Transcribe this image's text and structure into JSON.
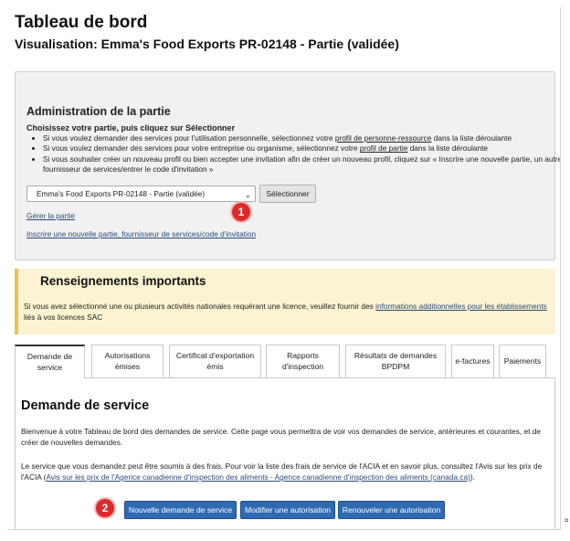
{
  "page": {
    "title": "Tableau de bord",
    "subtitle": "Visualisation: Emma's Food Exports PR-02148 - Partie (validée)"
  },
  "admin": {
    "heading": "Administration de la partie",
    "instruction": "Choisissez votre partie, puis cliquez sur Sélectionner",
    "bullets": [
      {
        "before": "Si vous voulez demander des services pour l'utilisation personnelle, sélectionnez votre ",
        "link": "profil de personne-ressource",
        "after": " dans la liste déroulante"
      },
      {
        "before": "Si vous voulez demander des services pour votre entreprise ou organisme, sélectionnez votre ",
        "link": "profil de partie",
        "after": " dans la liste déroulante"
      },
      {
        "text": "Si vous souhaiter créer un nouveau profil ou bien accepter une invitation afin de créer un nouveau profil, cliquez sur « Inscrire une nouvelle partie, un autre fournisseur de services/entrer le code d'invitation »"
      }
    ],
    "select_value": "Emma's Food Exports PR-02148 - Partie (validée)",
    "select_button": "Sélectionner",
    "manage_link": "Gérer la partie",
    "register_link": "Inscrire une nouvelle partie, fournisseur de services/code d'invitation",
    "callout": "1"
  },
  "info": {
    "heading": "Renseignements importants",
    "text_before": "Si vous avez sélectionné une ou plusieurs activités nationales requérant une licence, veuillez fournir des ",
    "link": "informations additionnelles pour les établissements",
    "text_after": " liés à vos licences SAC"
  },
  "tabs": [
    {
      "label": "Demande de service",
      "active": true
    },
    {
      "label": "Autorisations émises"
    },
    {
      "label": "Certificat d'exportation émis"
    },
    {
      "label": "Rapports d'inspection"
    },
    {
      "label": "Résultats de demandes BPDPM"
    },
    {
      "label": "e-factures"
    },
    {
      "label": "Paiements"
    }
  ],
  "panel": {
    "title": "Demande de service",
    "intro": "Bienvenue à votre Tableau de bord des demandes de service. Cette page vous permettra de voir vos demandes de service, antérieures et courantes, et de créer de nouvelles demandes.",
    "fees_before": "Le service que vous demandez peut être soumis à des frais. Pour voir la liste des frais de service de l'ACIA et en savoir plus, consultez l'Avis sur les prix de l'ACIA (",
    "fees_link": "Avis sur les prix de l'Agence canadienne d'inspection des aliments - Agence canadienne d'inspection des aliments (canada.ca)",
    "fees_after": ").",
    "callout": "2",
    "buttons": {
      "new_request": "Nouvelle demande de service",
      "modify": "Modifier une autorisation",
      "renew": "Renouveler une autorisation"
    }
  },
  "colors": {
    "callout": "#dd2a2a",
    "primary_button": "#2f6bb3",
    "info_background": "#fbf3d1",
    "info_border": "#e8c34f",
    "admin_background": "#f1f1f1"
  },
  "corner_mark": "¤"
}
